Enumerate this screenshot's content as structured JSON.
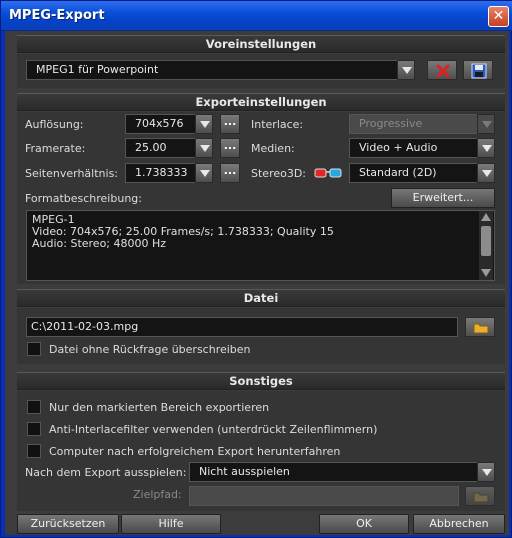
{
  "window": {
    "title": "MPEG-Export",
    "close_glyph": "✕"
  },
  "presets": {
    "header": "Voreinstellungen",
    "selected": "MPEG1 für Powerpoint"
  },
  "export_settings": {
    "header": "Exporteinstellungen",
    "resolution_label": "Auflösung:",
    "resolution_value": "704x576",
    "framerate_label": "Framerate:",
    "framerate_value": "25.00",
    "aspect_label": "Seitenverhältnis:",
    "aspect_value": "1.738333",
    "interlace_label": "Interlace:",
    "interlace_value": "Progressive",
    "media_label": "Medien:",
    "media_value": "Video + Audio",
    "stereo_label": "Stereo3D:",
    "stereo_value": "Standard (2D)",
    "dots_label": "...",
    "format_desc_label": "Formatbeschreibung:",
    "advanced_button": "Erweitert...",
    "format_desc_lines": [
      "MPEG-1",
      "Video: 704x576; 25.00 Frames/s; 1.738333; Quality 15",
      "Audio: Stereo; 48000 Hz"
    ]
  },
  "file": {
    "header": "Datei",
    "path": "C:\\2011-02-03.mpg",
    "overwrite_label": "Datei ohne Rückfrage überschreiben"
  },
  "misc": {
    "header": "Sonstiges",
    "opt1": "Nur den markierten Bereich exportieren",
    "opt2": "Anti-Interlacefilter verwenden (unterdrückt Zeilenflimmern)",
    "opt3": "Computer nach erfolgreichem Export herunterfahren",
    "playback_label": "Nach dem Export ausspielen:",
    "playback_value": "Nicht ausspielen",
    "target_label": "Zielpfad:"
  },
  "footer": {
    "reset": "Zurücksetzen",
    "help": "Hilfe",
    "ok": "OK",
    "cancel": "Abbrechen"
  }
}
